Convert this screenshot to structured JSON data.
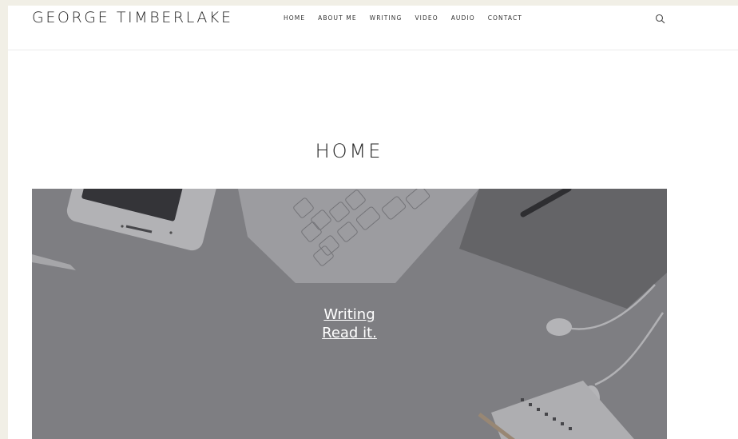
{
  "header": {
    "site_title": "GEORGE TIMBERLAKE",
    "nav": [
      "HOME",
      "ABOUT ME",
      "WRITING",
      "VIDEO",
      "AUDIO",
      "CONTACT"
    ],
    "search_icon": "search-icon"
  },
  "main": {
    "page_title": "HOME",
    "hero": {
      "link_title": "Writing",
      "link_cta": "Read it."
    }
  },
  "colors": {
    "background": "#f1efe6",
    "text": "#222222",
    "hero_overlay": "#6d6d72"
  }
}
